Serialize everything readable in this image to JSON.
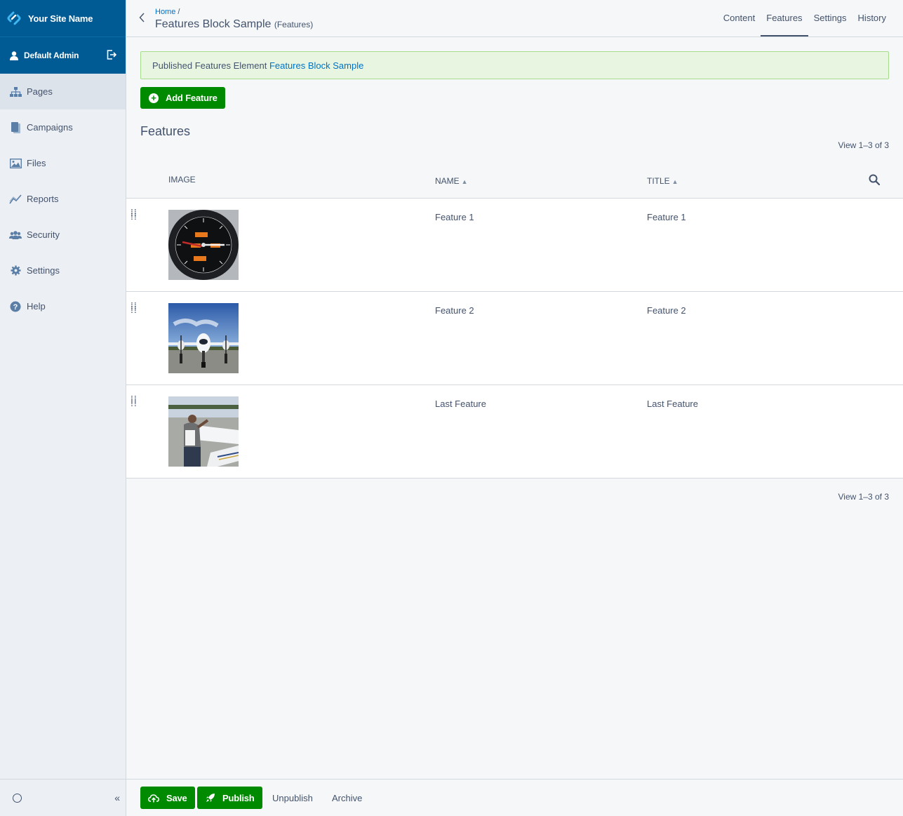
{
  "app": {
    "site_name": "Your Site Name",
    "user_name": "Default Admin"
  },
  "sidebar": {
    "items": [
      {
        "label": "Pages",
        "icon": "sitemap-icon"
      },
      {
        "label": "Campaigns",
        "icon": "campaigns-icon"
      },
      {
        "label": "Files",
        "icon": "image-icon"
      },
      {
        "label": "Reports",
        "icon": "chart-line-icon"
      },
      {
        "label": "Security",
        "icon": "users-icon"
      },
      {
        "label": "Settings",
        "icon": "gear-icon"
      },
      {
        "label": "Help",
        "icon": "question-icon"
      }
    ],
    "collapse_label": "«"
  },
  "header": {
    "breadcrumb_home": "Home",
    "breadcrumb_sep": "/",
    "title": "Features Block Sample",
    "title_suffix": "(Features)",
    "tabs": [
      {
        "label": "Content"
      },
      {
        "label": "Features"
      },
      {
        "label": "Settings"
      },
      {
        "label": "History"
      }
    ],
    "active_tab": "Features"
  },
  "alert": {
    "text": "Published Features Element",
    "link": "Features Block Sample"
  },
  "toolbar": {
    "add_label": "Add Feature"
  },
  "section": {
    "title": "Features",
    "view_count": "View 1–3 of 3"
  },
  "table": {
    "headers": {
      "image": "IMAGE",
      "name": "NAME",
      "title": "TITLE"
    },
    "rows": [
      {
        "name": "Feature 1",
        "title": "Feature 1",
        "image": "airspeed-indicator-image"
      },
      {
        "name": "Feature 2",
        "title": "Feature 2",
        "image": "airplane-front-image"
      },
      {
        "name": "Last Feature",
        "title": "Last Feature",
        "image": "pilot-airplane-image"
      }
    ]
  },
  "footer": {
    "save": "Save",
    "publish": "Publish",
    "unpublish": "Unpublish",
    "archive": "Archive"
  },
  "colors": {
    "brand": "#005a93",
    "primary_green": "#008a00",
    "link": "#0071c4",
    "alert_bg": "#e8f6e1"
  }
}
